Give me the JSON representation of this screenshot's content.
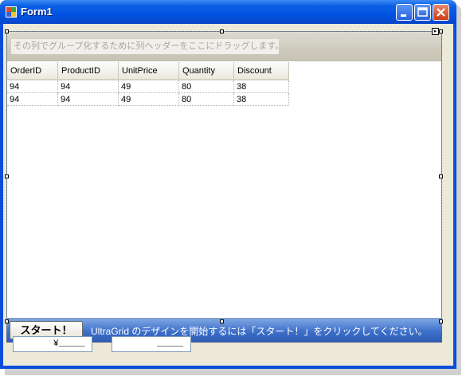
{
  "window": {
    "title": "Form1",
    "buttons": {
      "minimize": "minimize-icon",
      "maximize": "maximize-icon",
      "close": "close-icon"
    }
  },
  "grid": {
    "group_by_prompt": "その列でグループ化するために列ヘッダーをここにドラッグします。",
    "columns": [
      "OrderID",
      "ProductID",
      "UnitPrice",
      "Quantity",
      "Discount"
    ],
    "rows": [
      [
        "94",
        "94",
        "49",
        "80",
        "38"
      ],
      [
        "94",
        "94",
        "49",
        "80",
        "38"
      ]
    ]
  },
  "designer_bar": {
    "start_label": "スタート！",
    "hint": "UltraGrid のデザインを開始するには「スタート！」をクリックしてください。"
  },
  "inputs": {
    "currency_mask": "¥_____",
    "second_mask": "_____"
  },
  "colors": {
    "titlebar": "#0054e3",
    "client": "#ece9d8",
    "designer_bar": "#3d6fc8"
  }
}
